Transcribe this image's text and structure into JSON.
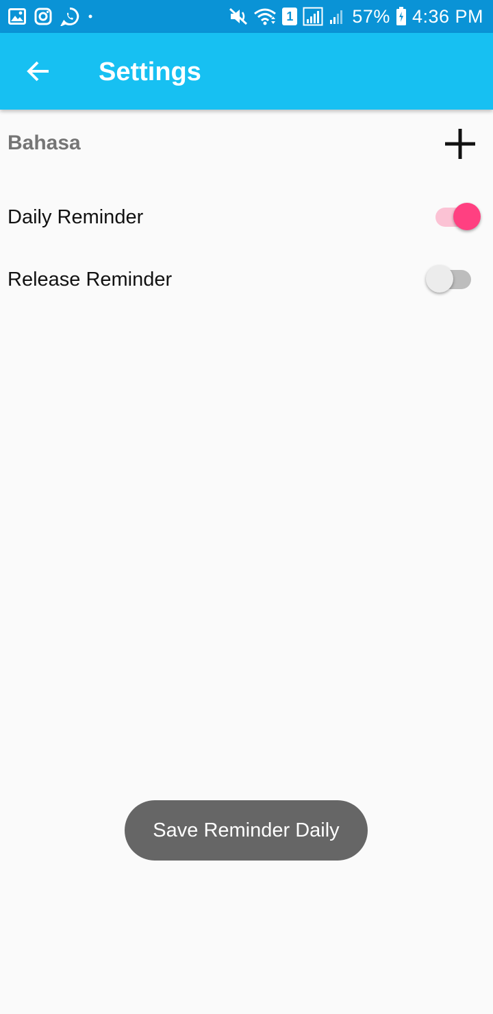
{
  "status_bar": {
    "battery": "57%",
    "time": "4:36 PM",
    "sim_slot": "1",
    "left_icons": [
      "gallery-icon",
      "instagram-icon",
      "whatsapp-icon",
      "dot-icon"
    ],
    "right_icons": [
      "mute-icon",
      "wifi-icon",
      "sim-1-icon",
      "signal-icon",
      "signal-2-icon",
      "battery-icon"
    ]
  },
  "app_bar": {
    "title": "Settings",
    "back_icon": "arrow-left-icon",
    "color": "#17c0f2"
  },
  "settings": {
    "language_label": "Bahasa",
    "add_icon": "plus-icon",
    "daily_reminder": {
      "label": "Daily Reminder",
      "checked": true
    },
    "release_reminder": {
      "label": "Release Reminder",
      "checked": false
    },
    "accent_color": "#ff4081"
  },
  "toast": {
    "message": "Save Reminder Daily"
  }
}
